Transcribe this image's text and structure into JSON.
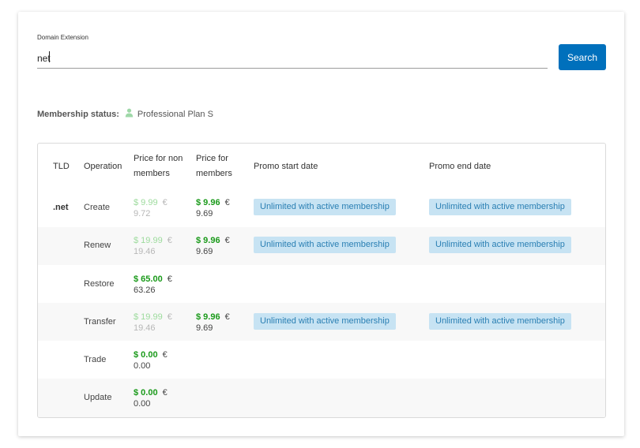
{
  "search": {
    "label": "Domain Extension",
    "value": "net",
    "button_label": "Search"
  },
  "membership": {
    "label": "Membership status:",
    "plan": "Professional Plan S",
    "icon": "user-icon"
  },
  "table": {
    "headers": {
      "tld": "TLD",
      "operation": "Operation",
      "price_non_members_line1": "Price for non",
      "price_non_members_line2": "members",
      "price_members_line1": "Price for",
      "price_members_line2": "members",
      "promo_start": "Promo start date",
      "promo_end": "Promo end date"
    },
    "tld": ".net",
    "rows": [
      {
        "operation": "Create",
        "non_usd": "$ 9.99",
        "non_eur": "9.72",
        "mem_usd": "$ 9.96",
        "mem_eur": "9.69",
        "promo_start": "Unlimited with active membership",
        "promo_end": "Unlimited with active membership"
      },
      {
        "operation": "Renew",
        "non_usd": "$ 19.99",
        "non_eur": "19.46",
        "mem_usd": "$ 9.96",
        "mem_eur": "9.69",
        "promo_start": "Unlimited with active membership",
        "promo_end": "Unlimited with active membership"
      },
      {
        "operation": "Restore",
        "non_usd": "$ 65.00",
        "non_eur": "63.26"
      },
      {
        "operation": "Transfer",
        "non_usd": "$ 19.99",
        "non_eur": "19.46",
        "mem_usd": "$ 9.96",
        "mem_eur": "9.69",
        "promo_start": "Unlimited with active membership",
        "promo_end": "Unlimited with active membership"
      },
      {
        "operation": "Trade",
        "non_usd": "$ 0.00",
        "non_eur": "0.00"
      },
      {
        "operation": "Update",
        "non_usd": "$ 0.00",
        "non_eur": "0.00"
      }
    ],
    "euro_symbol": "€"
  },
  "colors": {
    "primary_button": "#0070bc",
    "price_green": "#1a9a1a",
    "price_green_faded": "#9ddb9d",
    "promo_bg": "#c7e3f3",
    "promo_text": "#2a7fb3"
  }
}
